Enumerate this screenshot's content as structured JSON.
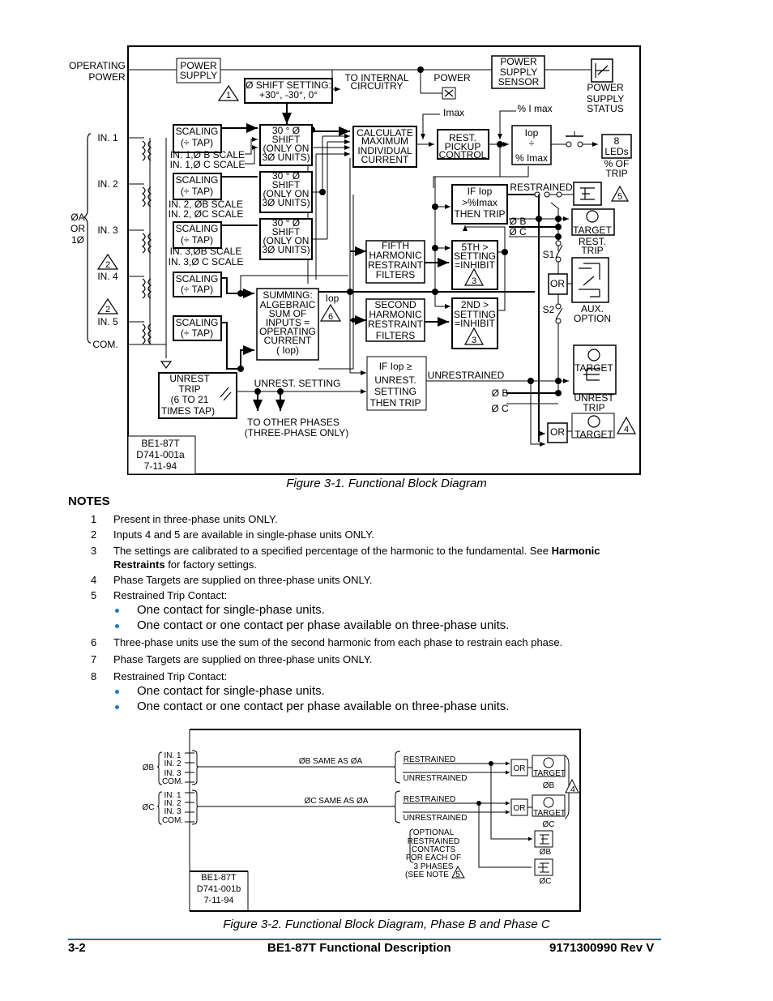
{
  "figure1": {
    "caption": "Figure 3-1. Functional Block Diagram",
    "labels": {
      "operating_power_1": "OPERATING",
      "operating_power_2": "POWER",
      "power_supply_1": "POWER",
      "power_supply_2": "SUPPLY",
      "phase_shift_setting_1": "Ø SHIFT SETTING:",
      "phase_shift_setting_2": "+30°, -30°, 0°",
      "to_internal_1": "TO INTERNAL",
      "to_internal_2": "CIRCUITRY",
      "power_led": "POWER",
      "ps_sensor_1": "POWER",
      "ps_sensor_2": "SUPPLY",
      "ps_sensor_3": "SENSOR",
      "ps_status_1": "POWER",
      "ps_status_2": "SUPPLY",
      "ps_status_3": "STATUS",
      "imax": "Imax",
      "pct_imax": "% I max",
      "calc_1": "CALCULATE",
      "calc_2": "MAXIMUM",
      "calc_3": "INDIVIDUAL",
      "calc_4": "CURRENT",
      "rest_1": "REST.",
      "rest_2": "PICKUP",
      "rest_3": "CONTROL",
      "ratio_top": "Iop",
      "ratio_bot": "% Imax",
      "leds_1": "8",
      "leds_2": "LEDs",
      "pct_trip_1": "% OF",
      "pct_trip_2": "TRIP",
      "in1": "IN. 1",
      "in2": "IN. 2",
      "in3": "IN. 3",
      "in4": "IN. 4",
      "in5": "IN. 5",
      "com": "COM.",
      "phase_a_1": "ØA",
      "phase_a_2": "OR",
      "phase_a_3": "1Ø",
      "scaling": "SCALING",
      "tap": "(÷ TAP)",
      "shift_1": "30 ° Ø",
      "shift_2": "SHIFT",
      "shift_3": "(ONLY ON",
      "shift_4": "3Ø UNITS)",
      "in1_b": "IN. 1,Ø B SCALE",
      "in1_c": "IN. 1,Ø C SCALE",
      "in2_b": "IN. 2, ØB SCALE",
      "in2_c": "IN. 2, ØC SCALE",
      "in3_b": "IN. 3,ØB SCALE",
      "in3_c": "IN. 3,Ø C SCALE",
      "sum_1": "SUMMING:",
      "sum_2": "ALGEBRAIC",
      "sum_3": "SUM OF",
      "sum_4": "INPUTS =",
      "sum_5": "OPERATING",
      "sum_6": "CURRENT",
      "sum_7": "( Iop)",
      "iop": "Iop",
      "fifth_1": "FIFTH",
      "fifth_2": "HARMONIC",
      "fifth_3": "RESTRAINT",
      "fifth_4": "FILTERS",
      "second_1": "SECOND",
      "second_2": "HARMONIC",
      "second_3": "RESTRAINT",
      "second_4": "FILTERS",
      "iftrip_1": "IF Iop",
      "iftrip_2": ">%Imax",
      "iftrip_3": "THEN TRIP",
      "fifth_set_1": "5TH >",
      "fifth_set_2": "SETTING",
      "fifth_set_3": "=INHIBIT",
      "second_set_1": "2ND >",
      "second_set_2": "SETTING",
      "second_set_3": "=INHIBIT",
      "restrained": "RESTRAINED",
      "phase_b": "Ø B",
      "phase_c": "Ø C",
      "target": "TARGET",
      "rest_trip_1": "REST.",
      "rest_trip_2": "TRIP",
      "s1": "S1",
      "s2": "S2",
      "or": "OR",
      "aux_1": "AUX.",
      "aux_2": "OPTION",
      "unrest_trip_1": "UNREST",
      "unrest_trip_2": "TRIP",
      "unrest_trip_3": "(6 TO 21",
      "unrest_trip_4": "TIMES TAP)",
      "unrest_setting": "UNREST. SETTING",
      "other_phases_1": "TO OTHER PHASES",
      "other_phases_2": "(THREE-PHASE ONLY)",
      "ifunrest_1": "IF Iop ≥",
      "ifunrest_2": "UNREST.",
      "ifunrest_3": "SETTING",
      "ifunrest_4": "THEN TRIP",
      "unrestrained": "UNRESTRAINED",
      "unrest_target_1": "UNREST",
      "unrest_target_2": "TRIP",
      "id_1": "BE1-87T",
      "id_2": "D741-001a",
      "id_3": "7-11-94",
      "note1": "1",
      "note2": "2",
      "note3": "3",
      "note4": "4",
      "note5": "5",
      "note6": "6"
    }
  },
  "notes": {
    "heading": "NOTES",
    "items": [
      {
        "num": "1",
        "text": "Present in three-phase units ONLY."
      },
      {
        "num": "2",
        "text": "Inputs 4 and 5 are available in single-phase units ONLY."
      },
      {
        "num": "3",
        "text_before": "The settings are calibrated to a specified percentage of the harmonic to the fundamental. See ",
        "bold": "Harmonic Restraints",
        "text_after": " for factory settings."
      },
      {
        "num": "4",
        "text": "Phase Targets are supplied on three-phase units ONLY."
      },
      {
        "num": "5",
        "text": "Restrained Trip Contact:",
        "bullets": [
          "One contact for single-phase units.",
          "One contact or one contact per phase available on three-phase units."
        ]
      },
      {
        "num": "6",
        "text": "Three-phase units use the sum of the second harmonic from each phase to restrain each phase."
      },
      {
        "num": "7",
        "text": "Phase Targets are supplied on three-phase units ONLY."
      },
      {
        "num": "8",
        "text": "Restrained Trip Contact:",
        "bullets": [
          "One contact for single-phase units.",
          "One contact or one contact per phase available on three-phase units."
        ]
      }
    ]
  },
  "figure2": {
    "caption": "Figure 3-2. Functional Block Diagram, Phase B and Phase C",
    "labels": {
      "phase_b": "ØB",
      "phase_c": "ØC",
      "in1": "IN. 1",
      "in2": "IN. 2",
      "in3": "IN. 3",
      "com": "COM.",
      "b_same": "ØB SAME AS ØA",
      "c_same": "ØC SAME AS ØA",
      "restrained": "RESTRAINED",
      "unrestrained": "UNRESTRAINED",
      "or": "OR",
      "target": "TARGET",
      "tgt_b": "ØB",
      "tgt_c": "ØC",
      "opt_1": "OPTIONAL",
      "opt_2": "RESTRAINED",
      "opt_3": "CONTACTS",
      "opt_4": "FOR EACH OF",
      "opt_5": "3 PHASES",
      "opt_6": "(SEE NOTE",
      "contact_b": "ØB",
      "contact_c": "ØC",
      "id_1": "BE1-87T",
      "id_2": "D741-001b",
      "id_3": "7-11-94",
      "note4": "4",
      "note5": "5"
    }
  },
  "footer": {
    "page": "3-2",
    "title": "BE1-87T Functional Description",
    "doc": "9171300990 Rev V",
    "rule_color": "#1f6fb0"
  }
}
